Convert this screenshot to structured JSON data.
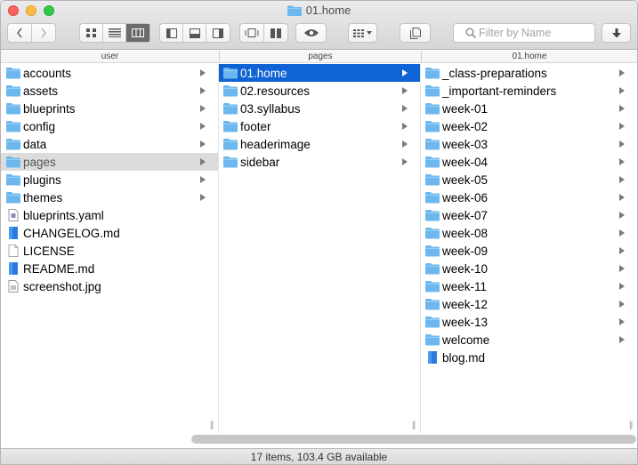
{
  "window": {
    "title": "01.home",
    "title_icon": "folder-icon"
  },
  "toolbar": {
    "back_icon": "chevron-left-icon",
    "forward_icon": "chevron-right-icon",
    "view_modes": [
      "icon-view-icon",
      "list-view-icon",
      "column-view-icon"
    ],
    "active_view": "column-view-icon",
    "panes": [
      "sidebar-pane-icon",
      "preview-bottom-icon",
      "preview-right-icon"
    ],
    "coverflow": [
      "coverflow-icon",
      "split-view-icon"
    ],
    "quicklook_icon": "eye-icon",
    "arrange_icon": "arrange-grid-icon",
    "share_icon": "share-document-icon",
    "download_icon": "download-arrow-icon",
    "search_placeholder": "Filter by Name"
  },
  "columns": [
    {
      "header": "user",
      "items": [
        {
          "name": "accounts",
          "type": "folder",
          "arrow": true,
          "state": ""
        },
        {
          "name": "assets",
          "type": "folder",
          "arrow": true,
          "state": ""
        },
        {
          "name": "blueprints",
          "type": "folder",
          "arrow": true,
          "state": ""
        },
        {
          "name": "config",
          "type": "folder",
          "arrow": true,
          "state": ""
        },
        {
          "name": "data",
          "type": "folder",
          "arrow": true,
          "state": ""
        },
        {
          "name": "pages",
          "type": "folder",
          "arrow": true,
          "state": "gray"
        },
        {
          "name": "plugins",
          "type": "folder",
          "arrow": true,
          "state": ""
        },
        {
          "name": "themes",
          "type": "folder",
          "arrow": true,
          "state": ""
        },
        {
          "name": "blueprints.yaml",
          "type": "yaml",
          "arrow": false,
          "state": ""
        },
        {
          "name": "CHANGELOG.md",
          "type": "md",
          "arrow": false,
          "state": ""
        },
        {
          "name": "LICENSE",
          "type": "doc",
          "arrow": false,
          "state": ""
        },
        {
          "name": "README.md",
          "type": "md",
          "arrow": false,
          "state": ""
        },
        {
          "name": "screenshot.jpg",
          "type": "image",
          "arrow": false,
          "state": ""
        }
      ]
    },
    {
      "header": "pages",
      "items": [
        {
          "name": "01.home",
          "type": "folder",
          "arrow": true,
          "state": "blue"
        },
        {
          "name": "02.resources",
          "type": "folder",
          "arrow": true,
          "state": ""
        },
        {
          "name": "03.syllabus",
          "type": "folder",
          "arrow": true,
          "state": ""
        },
        {
          "name": "footer",
          "type": "folder",
          "arrow": true,
          "state": ""
        },
        {
          "name": "headerimage",
          "type": "folder",
          "arrow": true,
          "state": ""
        },
        {
          "name": "sidebar",
          "type": "folder",
          "arrow": true,
          "state": ""
        }
      ]
    },
    {
      "header": "01.home",
      "items": [
        {
          "name": "_class-preparations",
          "type": "folder",
          "arrow": true,
          "state": ""
        },
        {
          "name": "_important-reminders",
          "type": "folder",
          "arrow": true,
          "state": ""
        },
        {
          "name": "week-01",
          "type": "folder",
          "arrow": true,
          "state": ""
        },
        {
          "name": "week-02",
          "type": "folder",
          "arrow": true,
          "state": ""
        },
        {
          "name": "week-03",
          "type": "folder",
          "arrow": true,
          "state": ""
        },
        {
          "name": "week-04",
          "type": "folder",
          "arrow": true,
          "state": ""
        },
        {
          "name": "week-05",
          "type": "folder",
          "arrow": true,
          "state": ""
        },
        {
          "name": "week-06",
          "type": "folder",
          "arrow": true,
          "state": ""
        },
        {
          "name": "week-07",
          "type": "folder",
          "arrow": true,
          "state": ""
        },
        {
          "name": "week-08",
          "type": "folder",
          "arrow": true,
          "state": ""
        },
        {
          "name": "week-09",
          "type": "folder",
          "arrow": true,
          "state": ""
        },
        {
          "name": "week-10",
          "type": "folder",
          "arrow": true,
          "state": ""
        },
        {
          "name": "week-11",
          "type": "folder",
          "arrow": true,
          "state": ""
        },
        {
          "name": "week-12",
          "type": "folder",
          "arrow": true,
          "state": ""
        },
        {
          "name": "week-13",
          "type": "folder",
          "arrow": true,
          "state": ""
        },
        {
          "name": "welcome",
          "type": "folder",
          "arrow": true,
          "state": ""
        },
        {
          "name": "blog.md",
          "type": "md",
          "arrow": false,
          "state": ""
        }
      ]
    }
  ],
  "status": {
    "text": "17 items, 103.4 GB available"
  },
  "colors": {
    "folder": "#6bb7ee",
    "selection_blue": "#0f63d4",
    "selection_gray": "#dcdcdc"
  }
}
